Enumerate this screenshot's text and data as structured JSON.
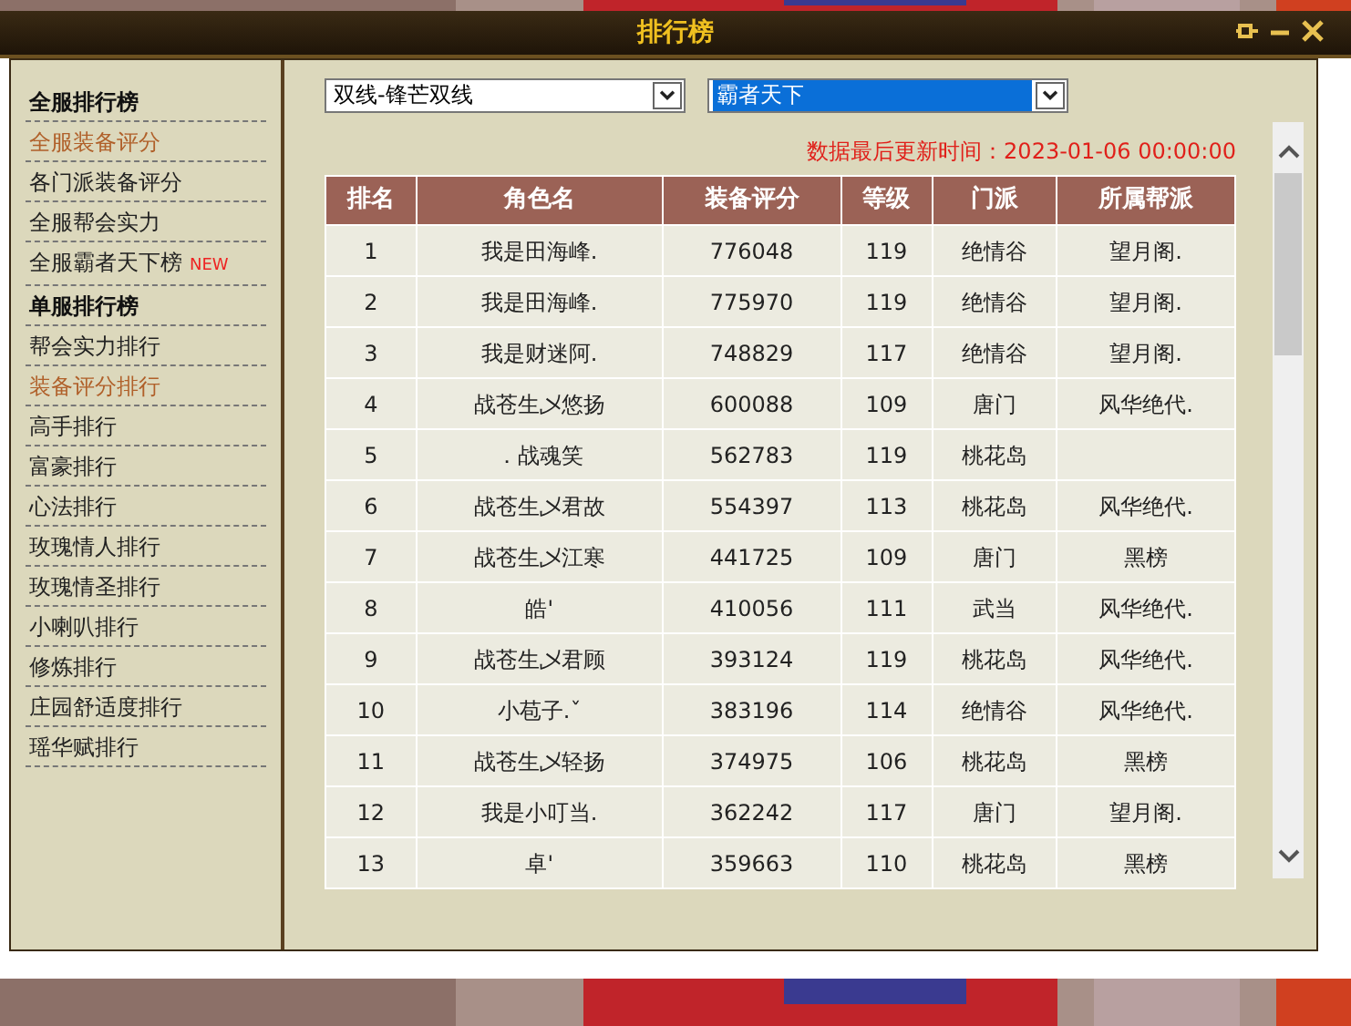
{
  "window": {
    "title": "排行榜"
  },
  "sidebar": {
    "items": [
      {
        "label": "全服排行榜",
        "kind": "header",
        "selected": false
      },
      {
        "label": "全服装备评分",
        "kind": "link",
        "selected": true
      },
      {
        "label": "各门派装备评分",
        "kind": "link",
        "selected": false
      },
      {
        "label": "全服帮会实力",
        "kind": "link",
        "selected": false
      },
      {
        "label": "全服霸者天下榜",
        "kind": "link",
        "selected": false,
        "badge": "NEW"
      },
      {
        "label": "单服排行榜",
        "kind": "header",
        "selected": false
      },
      {
        "label": "帮会实力排行",
        "kind": "link",
        "selected": false
      },
      {
        "label": "装备评分排行",
        "kind": "link",
        "selected": true
      },
      {
        "label": "高手排行",
        "kind": "link",
        "selected": false
      },
      {
        "label": "富豪排行",
        "kind": "link",
        "selected": false
      },
      {
        "label": "心法排行",
        "kind": "link",
        "selected": false
      },
      {
        "label": "玫瑰情人排行",
        "kind": "link",
        "selected": false
      },
      {
        "label": "玫瑰情圣排行",
        "kind": "link",
        "selected": false
      },
      {
        "label": "小喇叭排行",
        "kind": "link",
        "selected": false
      },
      {
        "label": "修炼排行",
        "kind": "link",
        "selected": false
      },
      {
        "label": "庄园舒适度排行",
        "kind": "link",
        "selected": false
      },
      {
        "label": "瑶华赋排行",
        "kind": "link",
        "selected": false
      }
    ]
  },
  "filters": [
    {
      "value": "双线-锋芒双线",
      "highlighted": false
    },
    {
      "value": "霸者天下",
      "highlighted": true
    }
  ],
  "update_time": "数据最后更新时间：2023-01-06 00:00:00",
  "table": {
    "columns": [
      "排名",
      "角色名",
      "装备评分",
      "等级",
      "门派",
      "所属帮派"
    ],
    "rows": [
      [
        "1",
        "我是田海峰.",
        "776048",
        "119",
        "绝情谷",
        "望月阁."
      ],
      [
        "2",
        "我是田海峰.",
        "775970",
        "119",
        "绝情谷",
        "望月阁."
      ],
      [
        "3",
        "我是财迷阿.",
        "748829",
        "117",
        "绝情谷",
        "望月阁."
      ],
      [
        "4",
        "战苍生乄悠扬",
        "600088",
        "109",
        "唐门",
        "风华绝代."
      ],
      [
        "5",
        "．战魂笑",
        "562783",
        "119",
        "桃花岛",
        ""
      ],
      [
        "6",
        "战苍生乄君故",
        "554397",
        "113",
        "桃花岛",
        "风华绝代."
      ],
      [
        "7",
        "战苍生乄江寒",
        "441725",
        "109",
        "唐门",
        "黑榜"
      ],
      [
        "8",
        "皓'",
        "410056",
        "111",
        "武当",
        "风华绝代."
      ],
      [
        "9",
        "战苍生乄君顾",
        "393124",
        "119",
        "桃花岛",
        "风华绝代."
      ],
      [
        "10",
        "小苞子.ˇ",
        "383196",
        "114",
        "绝情谷",
        "风华绝代."
      ],
      [
        "11",
        "战苍生乄轻扬",
        "374975",
        "106",
        "桃花岛",
        "黑榜"
      ],
      [
        "12",
        "我是小叮当.",
        "362242",
        "117",
        "唐门",
        "望月阁."
      ],
      [
        "13",
        "卓'",
        "359663",
        "110",
        "桃花岛",
        "黑榜"
      ]
    ]
  }
}
